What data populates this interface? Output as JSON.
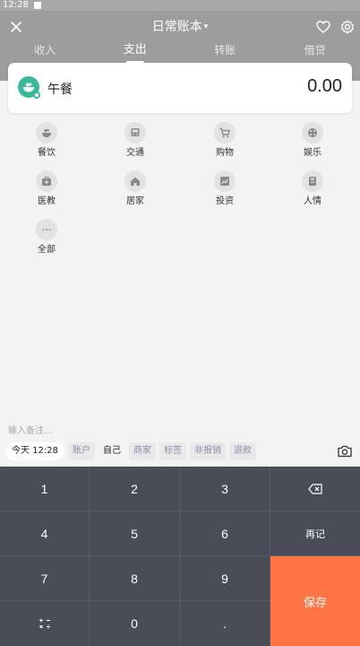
{
  "status": {
    "time": "12:28"
  },
  "header": {
    "title": "日常账本",
    "tabs": [
      {
        "label": "收入"
      },
      {
        "label": "支出"
      },
      {
        "label": "转账"
      },
      {
        "label": "借贷"
      }
    ]
  },
  "entry": {
    "category": "午餐",
    "amount": "0.00"
  },
  "categories": [
    {
      "label": "餐饮",
      "icon": "bowl-icon"
    },
    {
      "label": "交通",
      "icon": "bus-icon"
    },
    {
      "label": "购物",
      "icon": "cart-icon"
    },
    {
      "label": "娱乐",
      "icon": "game-icon"
    },
    {
      "label": "医教",
      "icon": "medkit-icon"
    },
    {
      "label": "居家",
      "icon": "home-icon"
    },
    {
      "label": "投资",
      "icon": "chart-icon"
    },
    {
      "label": "人情",
      "icon": "gift-icon"
    },
    {
      "label": "全部",
      "icon": "more-icon"
    }
  ],
  "note": {
    "placeholder": "输入备注..."
  },
  "chips": {
    "date": "今天 12:28",
    "account": "账户",
    "member": "自己",
    "merchant": "商家",
    "tag": "标签",
    "reimburse": "非报销",
    "refund": "退款"
  },
  "keypad": {
    "k1": "1",
    "k2": "2",
    "k3": "3",
    "k4": "4",
    "k5": "5",
    "k6": "6",
    "k7": "7",
    "k8": "8",
    "k9": "9",
    "k0": "0",
    "dot": ".",
    "again": "再记",
    "save": "保存"
  },
  "colors": {
    "accent": "#ff7444",
    "category": "#3bb89a",
    "keypad": "#4a4c58"
  }
}
